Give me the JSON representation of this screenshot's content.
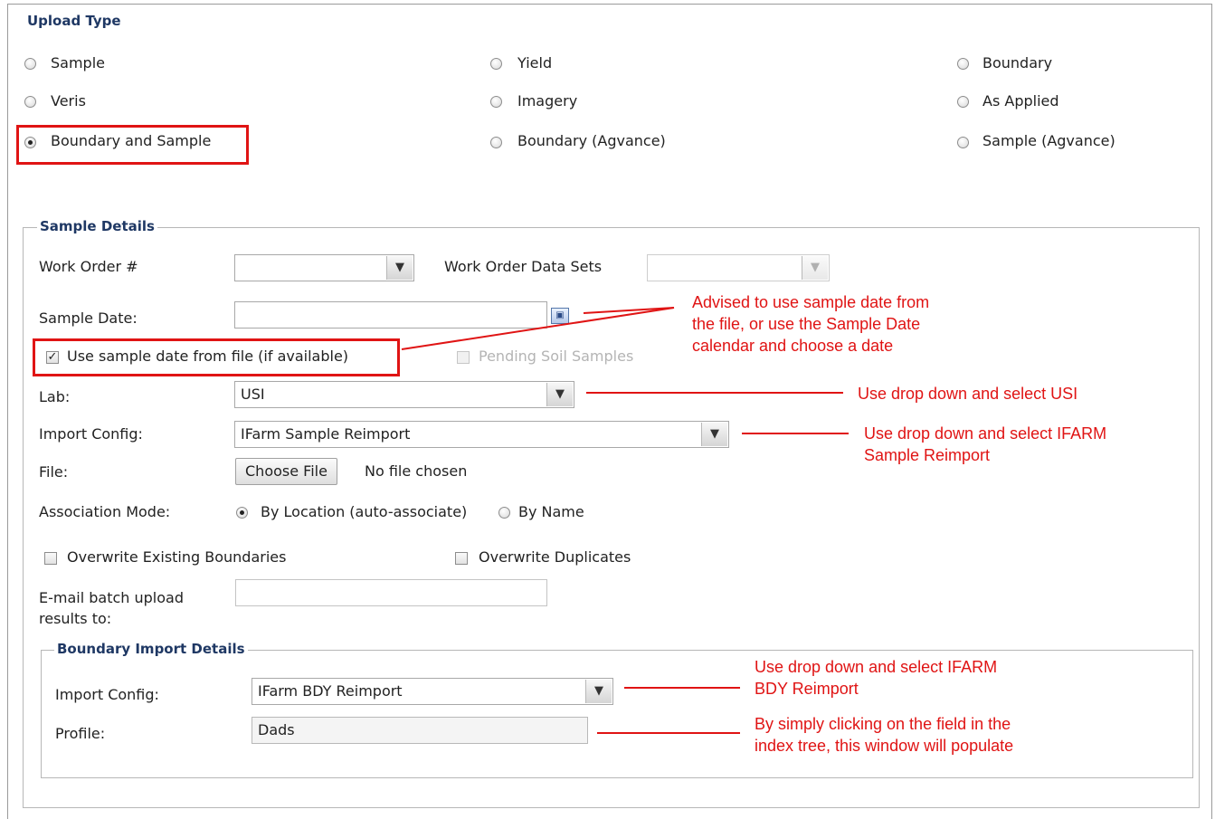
{
  "upload_type": {
    "heading": "Upload Type",
    "options": [
      {
        "label": "Sample",
        "selected": false
      },
      {
        "label": "Yield",
        "selected": false
      },
      {
        "label": "Boundary",
        "selected": false
      },
      {
        "label": "Veris",
        "selected": false
      },
      {
        "label": "Imagery",
        "selected": false
      },
      {
        "label": "As Applied",
        "selected": false
      },
      {
        "label": "Boundary and Sample",
        "selected": true
      },
      {
        "label": "Boundary (Agvance)",
        "selected": false
      },
      {
        "label": "Sample (Agvance)",
        "selected": false
      }
    ]
  },
  "sample_details": {
    "legend": "Sample Details",
    "work_order_label": "Work Order #",
    "work_order_value": "",
    "work_order_data_sets_label": "Work Order Data Sets",
    "work_order_data_sets_value": "",
    "sample_date_label": "Sample Date:",
    "sample_date_value": "",
    "use_sample_date_label": "Use sample date from file (if available)",
    "use_sample_date_checked": true,
    "pending_soil_label": "Pending Soil Samples",
    "lab_label": "Lab:",
    "lab_value": "USI",
    "import_config_label": "Import Config:",
    "import_config_value": "IFarm Sample Reimport",
    "file_label": "File:",
    "choose_file_label": "Choose File",
    "file_status": "No file chosen",
    "association_mode_label": "Association Mode:",
    "assoc_by_location_label": "By Location (auto-associate)",
    "assoc_by_name_label": "By Name",
    "overwrite_boundaries_label": "Overwrite Existing Boundaries",
    "overwrite_duplicates_label": "Overwrite Duplicates",
    "email_label_line1": "E-mail batch upload",
    "email_label_line2": "results to:",
    "email_value": ""
  },
  "boundary_import": {
    "legend": "Boundary Import Details",
    "import_config_label": "Import Config:",
    "import_config_value": "IFarm BDY Reimport",
    "profile_label": "Profile:",
    "profile_value": "Dads"
  },
  "annotations": {
    "sample_date_note": [
      "Advised to use sample date from",
      "the file, or use the Sample Date",
      "calendar and choose a date"
    ],
    "lab_note": "Use drop down and select USI",
    "import_config_note": [
      "Use drop down and select IFARM",
      "Sample Reimport"
    ],
    "bdy_config_note": [
      "Use drop down and select IFARM",
      "BDY Reimport"
    ],
    "profile_note": [
      "By simply clicking on the field in the",
      "index tree, this window will populate"
    ],
    "color": "#e01414"
  }
}
